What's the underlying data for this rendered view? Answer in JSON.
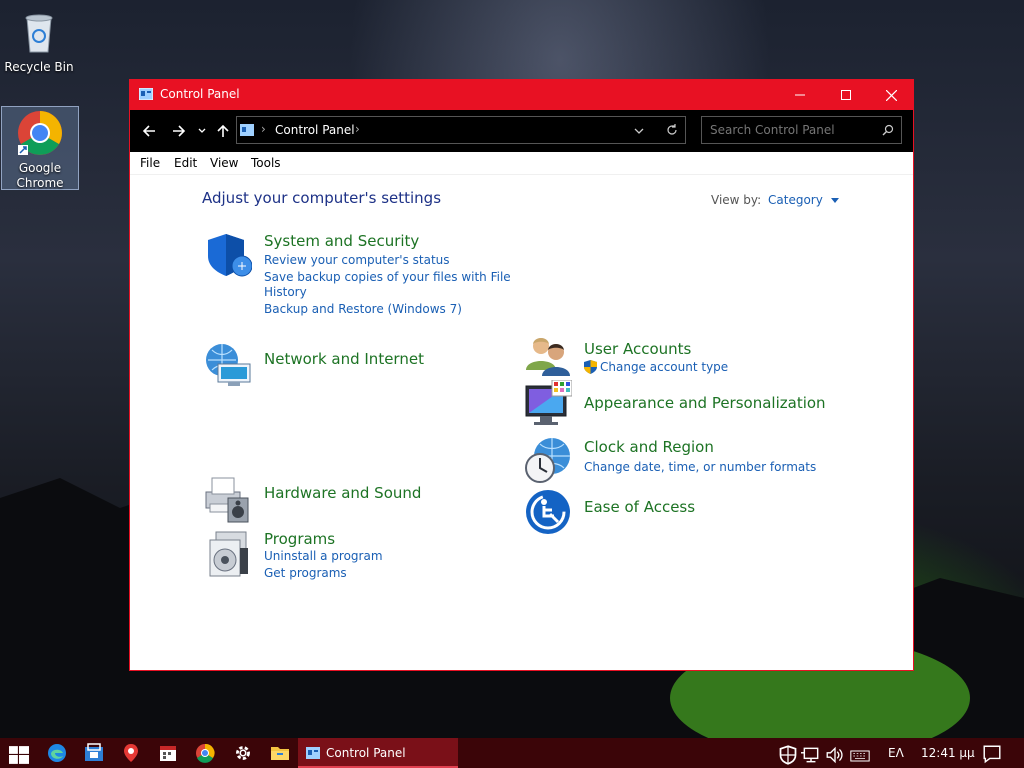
{
  "desktop": {
    "recycle_bin": "Recycle Bin",
    "chrome_line1": "Google",
    "chrome_line2": "Chrome"
  },
  "window": {
    "title": "Control Panel",
    "breadcrumb": "Control Panel",
    "search_placeholder": "Search Control Panel",
    "menu": [
      "File",
      "Edit",
      "View",
      "Tools"
    ],
    "page_title": "Adjust your computer's settings",
    "view_by_label": "View by:",
    "view_by_value": "Category"
  },
  "categories": {
    "system_security": {
      "title": "System and Security",
      "links": [
        "Review your computer's status",
        "Save backup copies of your files with File",
        "History",
        "Backup and Restore (Windows 7)"
      ]
    },
    "network": {
      "title": "Network and Internet"
    },
    "hardware": {
      "title": "Hardware and Sound"
    },
    "programs": {
      "title": "Programs",
      "links": [
        "Uninstall a program",
        "Get programs"
      ]
    },
    "user_accounts": {
      "title": "User Accounts",
      "links": [
        "Change account type"
      ]
    },
    "appearance": {
      "title": "Appearance and Personalization"
    },
    "clock": {
      "title": "Clock and Region",
      "links": [
        "Change date, time, or number formats"
      ]
    },
    "ease": {
      "title": "Ease of Access"
    }
  },
  "taskbar": {
    "active_window": "Control Panel",
    "language": "ΕΛ",
    "clock": "12:41 μμ"
  },
  "colors": {
    "accent": "#e81123",
    "taskbar": "#3b0508",
    "link": "#1a5fb4",
    "category_title": "#1d7324"
  }
}
